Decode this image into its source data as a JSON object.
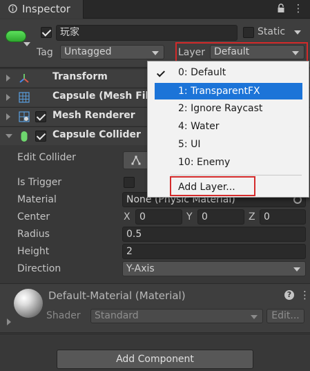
{
  "tab": {
    "title": "Inspector",
    "menu_glyph": "⋮"
  },
  "header": {
    "name": "玩家",
    "static_label": "Static",
    "tag_label": "Tag",
    "tag_value": "Untagged",
    "layer_label": "Layer",
    "layer_value": "Default"
  },
  "components": [
    {
      "name": "Transform"
    },
    {
      "name": "Capsule (Mesh Filt"
    },
    {
      "name": "Mesh Renderer"
    },
    {
      "name": "Capsule Collider"
    }
  ],
  "collider": {
    "edit_label": "Edit Collider",
    "is_trigger_label": "Is Trigger",
    "material_label": "Material",
    "material_value": "None (Physic Material)",
    "center_label": "Center",
    "x_label": "X",
    "x_value": "0",
    "y_label": "Y",
    "y_value": "0",
    "z_label": "Z",
    "z_value": "0",
    "radius_label": "Radius",
    "radius_value": "0.5",
    "height_label": "Height",
    "height_value": "2",
    "direction_label": "Direction",
    "direction_value": "Y-Axis"
  },
  "material_panel": {
    "title": "Default-Material (Material)",
    "shader_label": "Shader",
    "shader_value": "Standard",
    "edit_button": "Edit..."
  },
  "add_component": "Add Component",
  "layer_menu": {
    "items": [
      "0: Default",
      "1: TransparentFX",
      "2: Ignore Raycast",
      "4: Water",
      "5: UI",
      "10: Enemy"
    ],
    "checked_index": 0,
    "selected_index": 1,
    "add_layer": "Add Layer..."
  },
  "colors": {
    "accent": "#1c74d8",
    "highlight_box": "#d42a2a",
    "panel_bg": "#383838"
  }
}
